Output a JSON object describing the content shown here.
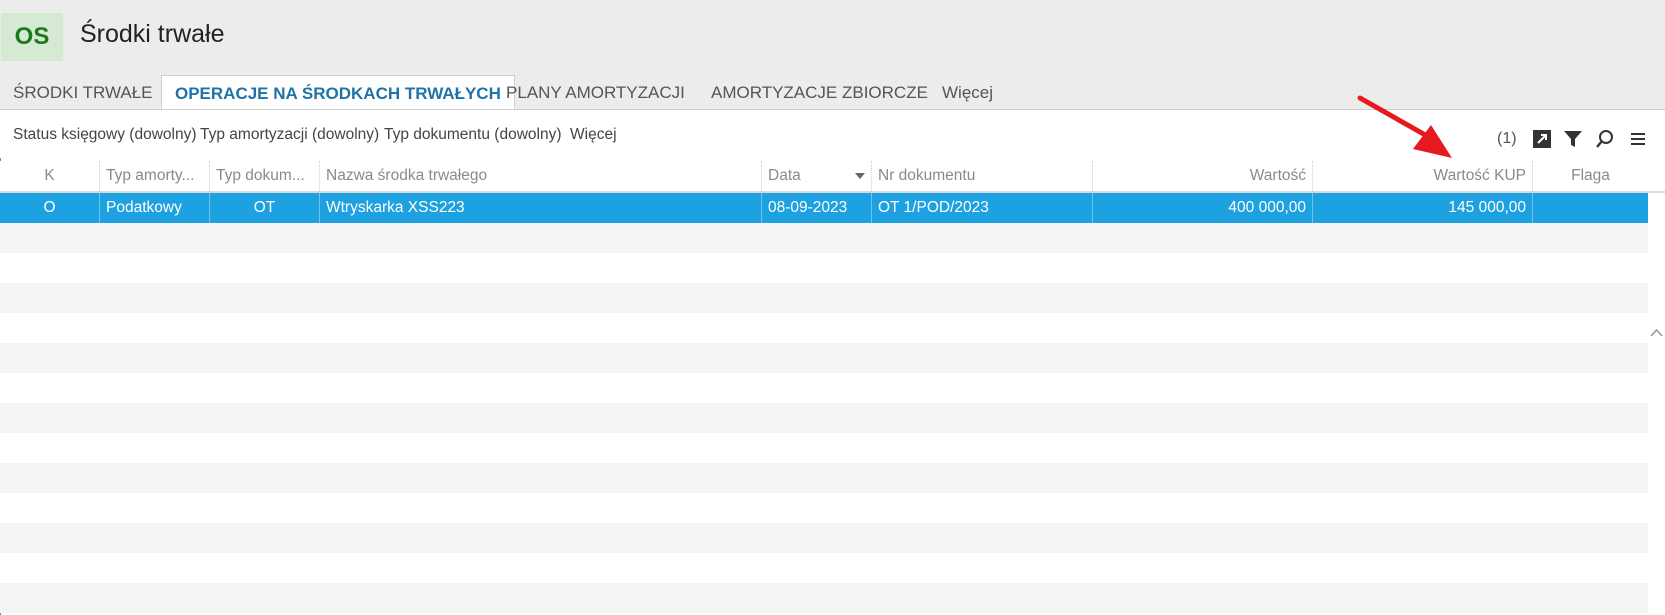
{
  "app": {
    "badge": "OS",
    "title": "Środki trwałe"
  },
  "tabs": [
    {
      "label": "ŚRODKI TRWAŁE"
    },
    {
      "label": "OPERACJE NA ŚRODKACH TRWAŁYCH"
    },
    {
      "label": "PLANY AMORTYZACJI"
    },
    {
      "label": "AMORTYZACJE ZBIORCZE"
    },
    {
      "label": "Więcej"
    }
  ],
  "filters": [
    {
      "label": "Status księgowy (dowolny)"
    },
    {
      "label": "Typ amortyzacji (dowolny)"
    },
    {
      "label": "Typ dokumentu (dowolny)"
    },
    {
      "label": "Więcej"
    }
  ],
  "toolbar": {
    "count": "(1)",
    "icons": [
      "export-icon",
      "filter-icon",
      "search-icon",
      "menu-icon"
    ]
  },
  "grid": {
    "columns": [
      "K",
      "Typ amorty...",
      "Typ dokum...",
      "Nazwa środka trwałego",
      "Data",
      "Nr dokumentu",
      "Wartość",
      "Wartość KUP",
      "Flaga"
    ],
    "sorted_column": "Data",
    "rows": [
      {
        "k": "O",
        "typ_amortyzacji": "Podatkowy",
        "typ_dokumentu": "OT",
        "nazwa": "Wtryskarka XSS223",
        "data": "08-09-2023",
        "nr_dokumentu": "OT 1/POD/2023",
        "wartosc": "400 000,00",
        "wartosc_kup": "145 000,00",
        "flaga": ""
      }
    ]
  },
  "annotation": {
    "arrow_color": "#e8191e",
    "points_to": "Wartość KUP"
  },
  "colors": {
    "accent": "#1f73a8",
    "selection": "#1ea1e0",
    "badge_bg": "#d6e9d3",
    "badge_fg": "#1b7a1b"
  }
}
